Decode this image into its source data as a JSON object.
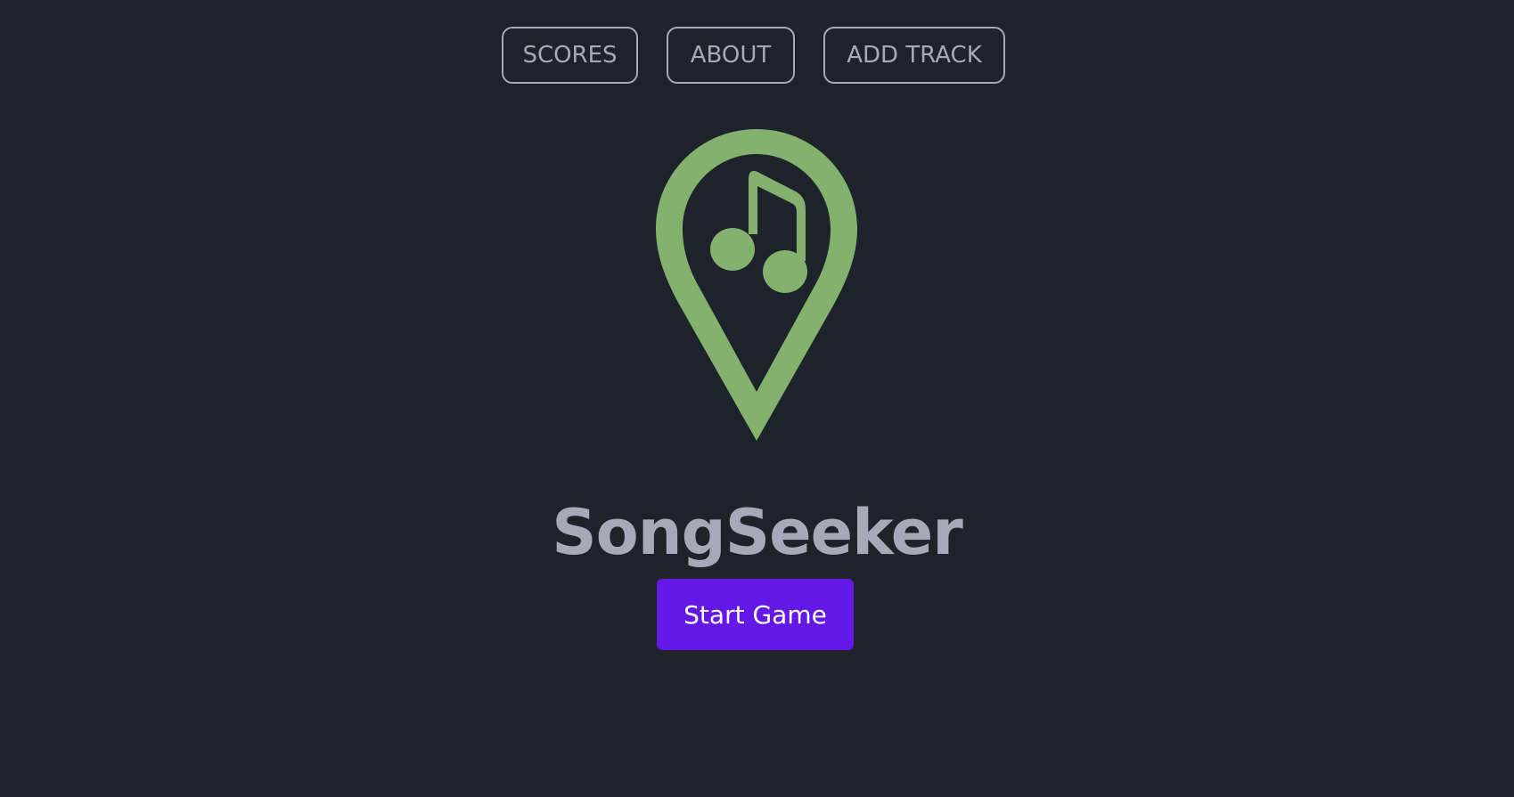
{
  "nav": {
    "scores_label": "SCORES",
    "about_label": "ABOUT",
    "add_track_label": "ADD TRACK"
  },
  "logo": {
    "icon": "map-pin-music-note-icon",
    "color": "#83b26f"
  },
  "app": {
    "title": "SongSeeker"
  },
  "actions": {
    "start_label": "Start Game"
  },
  "colors": {
    "background": "#1d222b",
    "text_muted": "#a6aab8",
    "primary": "#6418e6"
  }
}
